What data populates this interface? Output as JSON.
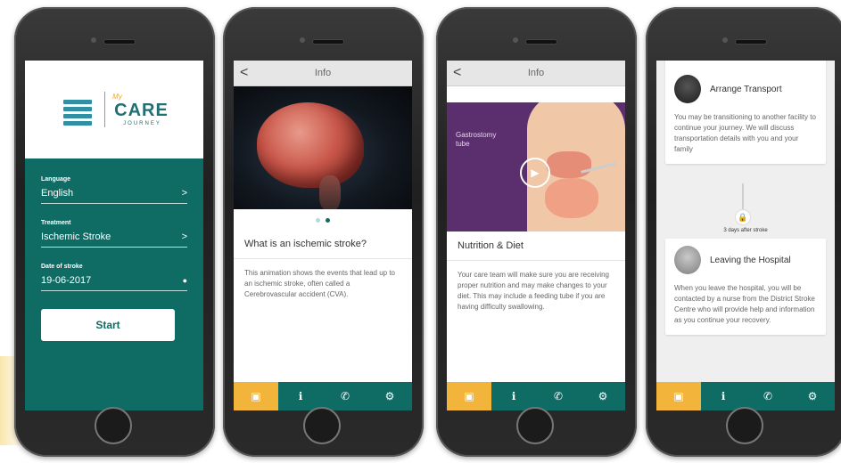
{
  "phone1": {
    "logo_text": "CARE",
    "logo_sub": "JOURNEY",
    "logo_my": "My",
    "fields": [
      {
        "label": "Language",
        "value": "English",
        "action": ">"
      },
      {
        "label": "Treatment",
        "value": "Ischemic Stroke",
        "action": ">"
      },
      {
        "label": "Date of stroke",
        "value": "19-06-2017",
        "action": "●"
      }
    ],
    "start_label": "Start"
  },
  "phone2": {
    "title": "Info",
    "back": "<",
    "heading": "What is an ischemic stroke?",
    "body": "This animation shows the events that lead up to an ischemic stroke, often called a Cerebrovascular accident (CVA)."
  },
  "phone3": {
    "title": "Info",
    "back": "<",
    "video_label": "Gastrostomy tube",
    "heading": "Nutrition & Diet",
    "body": "Your care team will make sure you are receiving proper nutrition and may make changes to your diet. This may include a feeding tube if you are having difficulty swallowing."
  },
  "phone4": {
    "card1_title": "Arrange Transport",
    "card1_body": "You may be transitioning to another facility to continue your journey. We will discuss transportation details with you and your family",
    "days_label": "3 days after stroke",
    "card2_title": "Leaving the Hospital",
    "card2_body": "When you leave the hospital, you will be contacted by a nurse from the District Stroke Centre who will provide help and information as you continue your recovery."
  },
  "tabs": [
    {
      "icon": "briefcase-icon",
      "glyph": "▣"
    },
    {
      "icon": "info-icon",
      "glyph": "ℹ"
    },
    {
      "icon": "phone-icon",
      "glyph": "✆"
    },
    {
      "icon": "gear-icon",
      "glyph": "⚙"
    }
  ],
  "colors": {
    "teal": "#0e6c65",
    "accent": "#f3b43c"
  }
}
